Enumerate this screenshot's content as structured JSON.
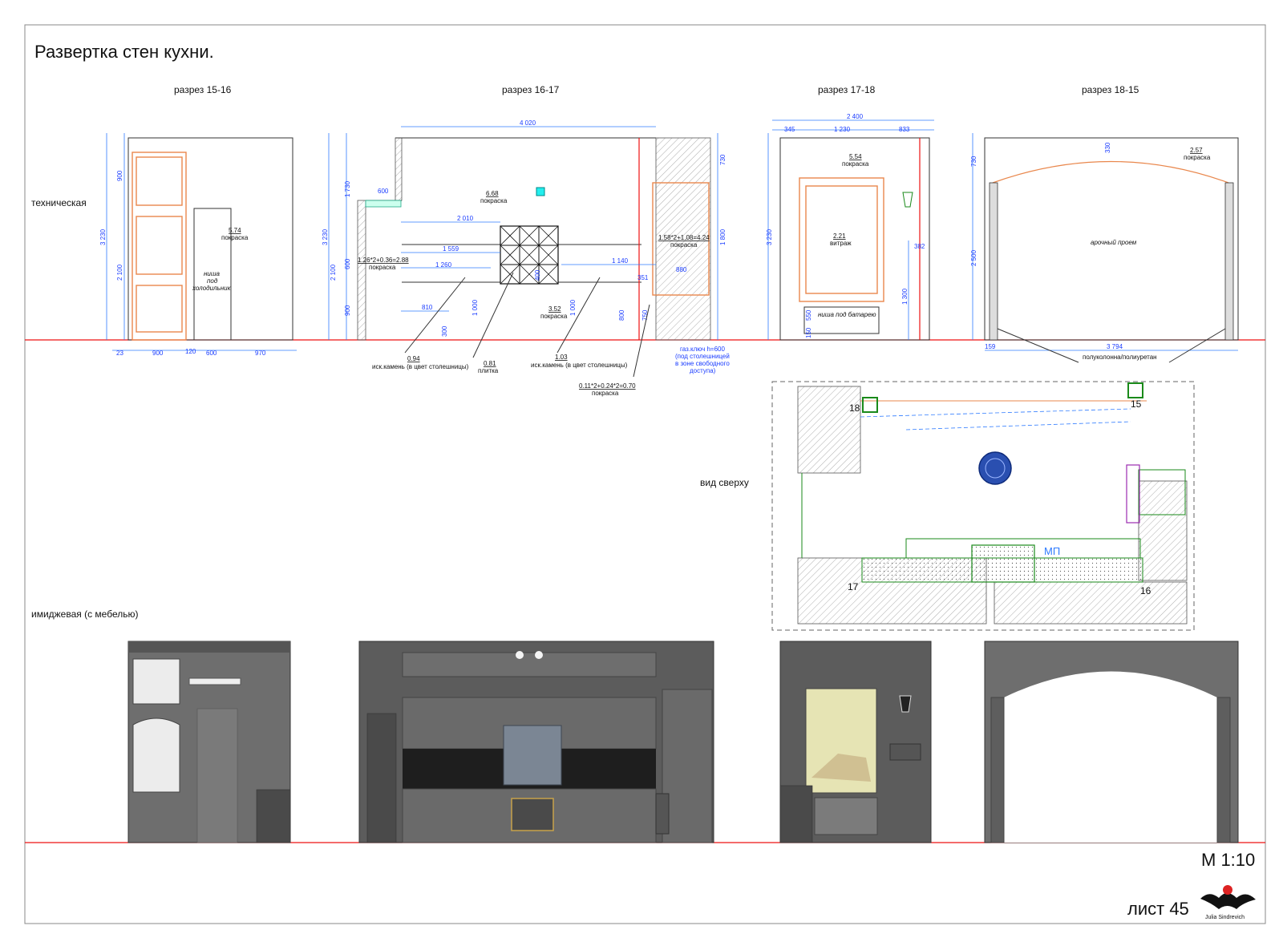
{
  "title": "Развертка стен кухни.",
  "scale": "М 1:10",
  "sheet": "лист 45",
  "logo_text": "Julia Sindrevich",
  "row_labels": {
    "technical": "техническая",
    "image": "имиджевая (с мебелью)",
    "top_view": "вид сверху"
  },
  "sections": [
    {
      "title": "разрез 15-16"
    },
    {
      "title": "разрез 16-17"
    },
    {
      "title": "разрез 17-18"
    },
    {
      "title": "разрез 18-15"
    }
  ],
  "s1": {
    "dims": [
      "900",
      "3 230",
      "2 100",
      "23",
      "900",
      "120",
      "600",
      "970"
    ],
    "area_value": "5.74",
    "area_label": "покраска",
    "niche": [
      "ниша",
      "под",
      "холодильник"
    ]
  },
  "s2": {
    "dims": [
      "4 020",
      "1 730",
      "3 230",
      "600",
      "2 100",
      "900",
      "600",
      "2 010",
      "1 559",
      "1 260",
      "1 140",
      "880",
      "351",
      "810",
      "1 000",
      "300",
      "1 000",
      "800",
      "750",
      "730",
      "1 800",
      "400"
    ],
    "area_main_value": "6.68",
    "area_main_label": "покраска",
    "left_formula": "1.26*2+0.36=2.88",
    "left_label": "покраска",
    "right_formula": "1.58*2+1.08=4.24",
    "right_label": "покраска",
    "bottom_value": "3.52",
    "bottom_label": "покраска",
    "callout1_value": "0.94",
    "callout1_label": "иск.камень (в цвет столешницы)",
    "callout2_value": "0.81",
    "callout2_label": "плитка",
    "callout3_value": "1.03",
    "callout3_label": "иск.камень (в цвет столешницы)",
    "callout4_value": "0.11*2+0.24*2=0.70",
    "callout4_label": "покраска",
    "gas_note": [
      "газ.ключ h=600",
      "(под столешницей",
      "в зоне свободного",
      "доступа)"
    ]
  },
  "s3": {
    "dims": [
      "2 400",
      "345",
      "1 230",
      "833",
      "3 230",
      "550",
      "150",
      "1 300",
      "382"
    ],
    "area_value": "5.54",
    "area_label": "покраска",
    "glass_value": "2.21",
    "glass_label": "витраж",
    "niche": "ниша под батарею"
  },
  "s4": {
    "dims": [
      "730",
      "330",
      "2 500",
      "159",
      "3 794"
    ],
    "area_value": "2.57",
    "area_label": "покраска",
    "arch": "арочный проем",
    "column_note": "полуколонна/полиуретан"
  },
  "plan": {
    "marks": [
      "18",
      "15",
      "17",
      "16"
    ],
    "mp": "МП"
  },
  "colors": {
    "wall_line": "#333333",
    "dimension": "#2f7bff",
    "floor_line": "#e11111",
    "frame_orange": "#e9874c",
    "plan_green": "#22aa22",
    "render_gray": "#6e6e6e"
  }
}
